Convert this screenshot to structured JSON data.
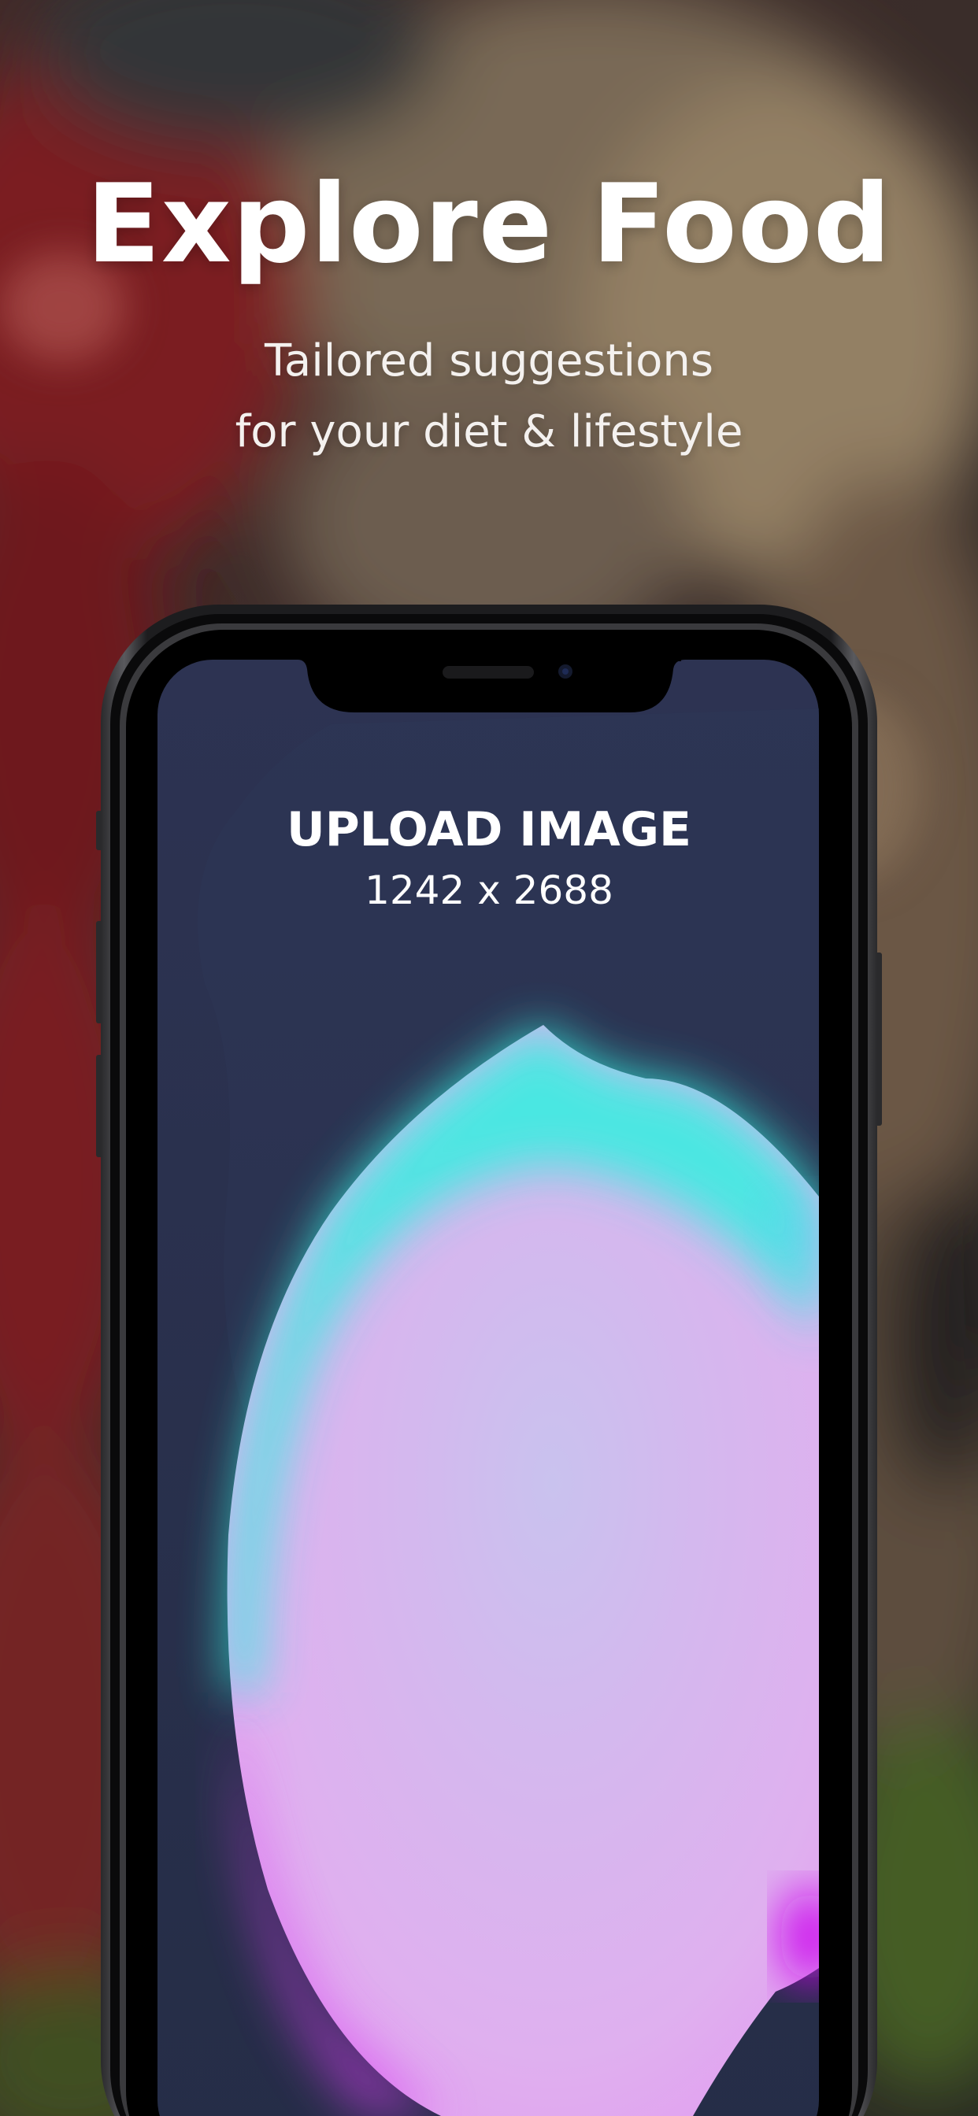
{
  "headline": "Explore Food",
  "subtitle": {
    "line1": "Tailored suggestions",
    "line2": "for your diet & lifestyle"
  },
  "phone_screen": {
    "upload_title": "UPLOAD IMAGE",
    "upload_size": "1242 x 2688"
  },
  "colors": {
    "text": "#ffffff",
    "screen_bg": "#2a3350",
    "blob_teal": "#35f2df",
    "blob_lavender": "#d7b6ee",
    "blob_magenta": "#d11cf0",
    "frame": "#1c1c1e"
  }
}
